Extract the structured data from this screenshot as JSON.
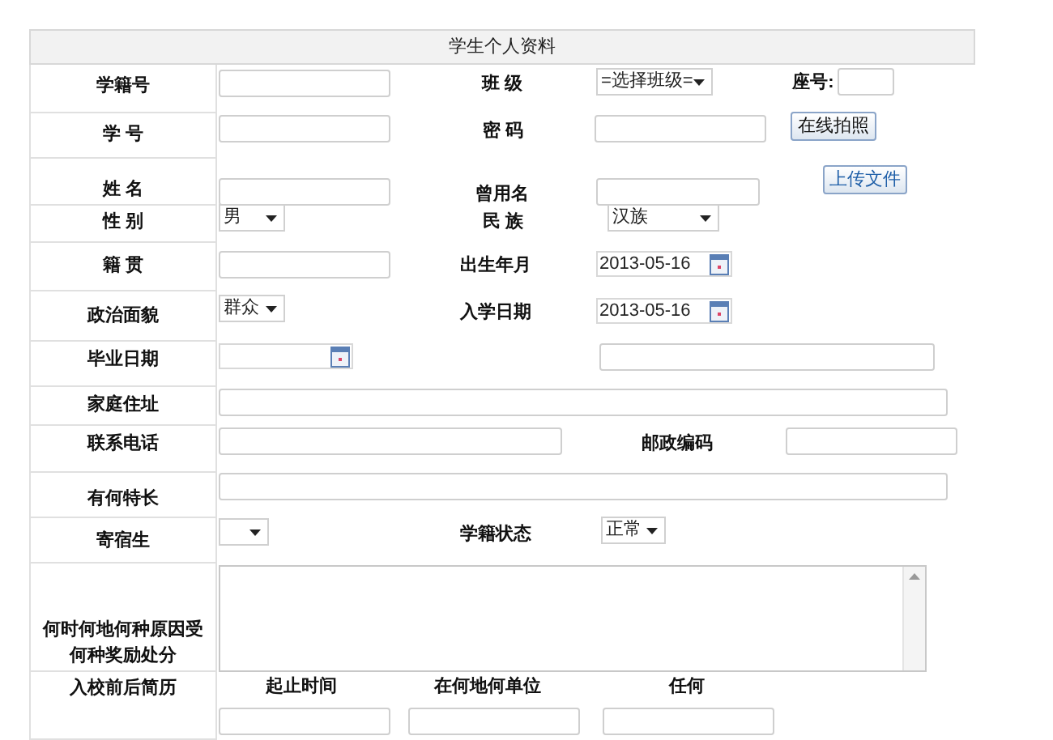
{
  "title": "学生个人资料",
  "rows": [
    {
      "label": "学籍号",
      "items": [
        {
          "kind": "input"
        },
        {
          "kind": "text",
          "text": "班 级"
        },
        {
          "kind": "select",
          "value": "=选择班级="
        },
        {
          "kind": "text",
          "text": "座号:"
        },
        {
          "kind": "input"
        }
      ]
    },
    {
      "label": "学 号",
      "items": [
        {
          "kind": "input"
        },
        {
          "kind": "text",
          "text": "密 码"
        },
        {
          "kind": "input"
        },
        {
          "kind": "button",
          "text": "在线拍照"
        }
      ]
    },
    {
      "label": "姓 名",
      "items": [
        {
          "kind": "input"
        },
        {
          "kind": "text",
          "text": "曾用名"
        },
        {
          "kind": "input"
        },
        {
          "kind": "button",
          "text": "上传文件"
        }
      ]
    },
    {
      "label": "性 别",
      "items": [
        {
          "kind": "select",
          "value": "男"
        },
        {
          "kind": "text",
          "text": "民 族"
        },
        {
          "kind": "select",
          "value": "汉族"
        }
      ]
    },
    {
      "label": "籍 贯",
      "items": [
        {
          "kind": "input"
        },
        {
          "kind": "text",
          "text": "出生年月"
        },
        {
          "kind": "date",
          "value": "2013-05-16"
        }
      ]
    },
    {
      "label": "政治面貌",
      "items": [
        {
          "kind": "select",
          "value": "群众"
        },
        {
          "kind": "text",
          "text": "入学日期"
        },
        {
          "kind": "date",
          "value": "2013-05-16"
        }
      ]
    },
    {
      "label": "毕业日期",
      "items": [
        {
          "kind": "date"
        },
        {
          "kind": "input"
        }
      ]
    },
    {
      "label": "家庭住址",
      "items": [
        {
          "kind": "input"
        }
      ]
    },
    {
      "label": "联系电话",
      "items": [
        {
          "kind": "input"
        },
        {
          "kind": "text",
          "text": "邮政编码"
        },
        {
          "kind": "input"
        }
      ]
    },
    {
      "label": "有何特长",
      "items": [
        {
          "kind": "input"
        }
      ]
    },
    {
      "label": "寄宿生",
      "items": [
        {
          "kind": "select"
        },
        {
          "kind": "text",
          "text": "学籍状态"
        },
        {
          "kind": "select",
          "value": "正常"
        }
      ]
    },
    {
      "label": "何时何地何种原因受何种奖励处分",
      "items": [
        {
          "kind": "textarea"
        }
      ]
    },
    {
      "label": "入校前后简历",
      "items": [
        {
          "kind": "text",
          "text": "起止时间"
        },
        {
          "kind": "text",
          "text": "在何地何单位"
        },
        {
          "kind": "text",
          "text": "任何"
        },
        {
          "kind": "input"
        },
        {
          "kind": "input"
        },
        {
          "kind": "input"
        }
      ]
    }
  ]
}
